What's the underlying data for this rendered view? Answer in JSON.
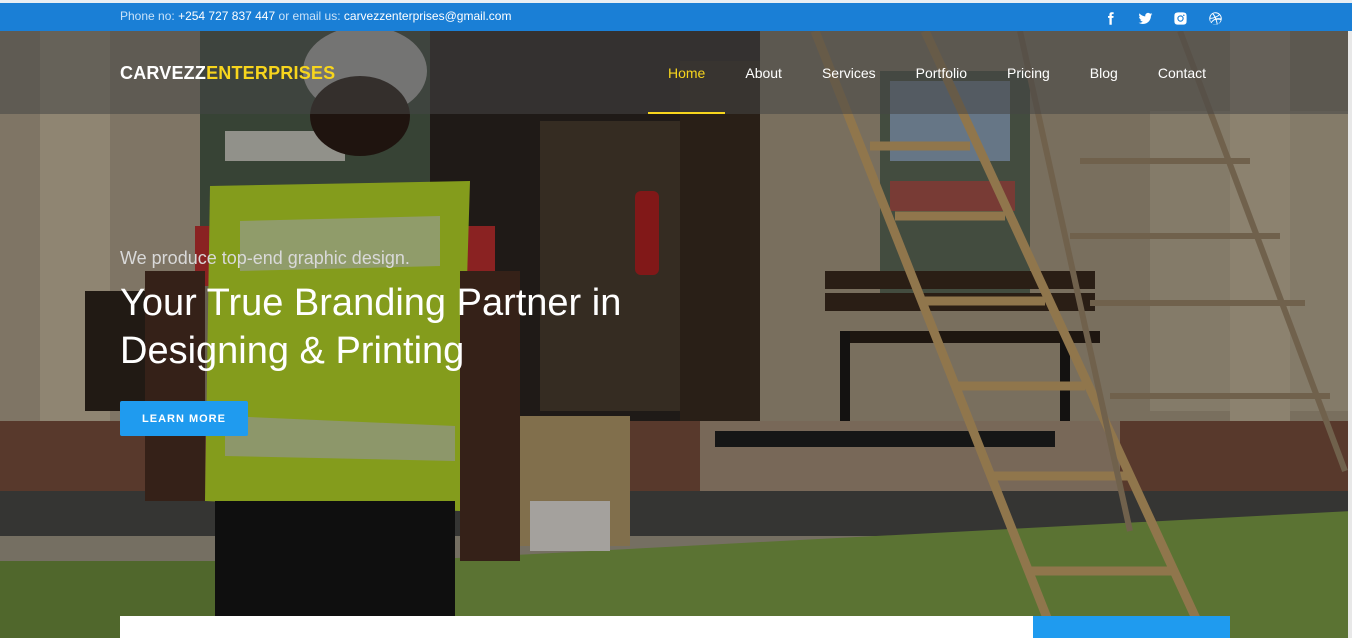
{
  "topbar": {
    "phone_label": "Phone no:",
    "phone_value": "+254 727 837 447",
    "email_label": "or email us:",
    "email_value": "carvezzenterprises@gmail.com",
    "socials": [
      "facebook-icon",
      "twitter-icon",
      "instagram-icon",
      "dribbble-icon"
    ]
  },
  "brand": {
    "part1": "CARVEZZ",
    "part2": "ENTERPRISES"
  },
  "nav": {
    "items": [
      {
        "label": "Home",
        "active": true
      },
      {
        "label": "About"
      },
      {
        "label": "Services"
      },
      {
        "label": "Portfolio"
      },
      {
        "label": "Pricing"
      },
      {
        "label": "Blog"
      },
      {
        "label": "Contact"
      }
    ]
  },
  "hero": {
    "tagline": "We produce top-end graphic design.",
    "headline_line1": "Your True Branding Partner in",
    "headline_line2": "Designing & Printing",
    "cta_label": "LEARN MORE"
  },
  "colors": {
    "topbar": "#1a7fd6",
    "accent_yellow": "#f7d51d",
    "button_blue": "#1f9bef"
  }
}
